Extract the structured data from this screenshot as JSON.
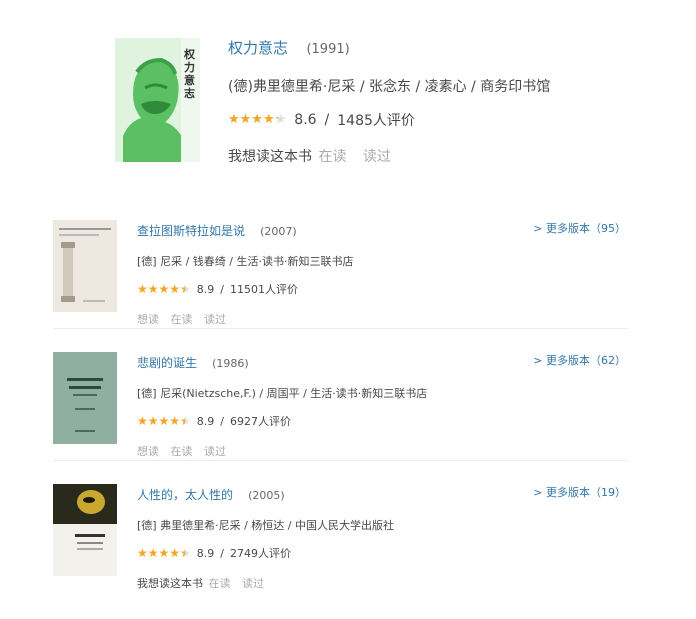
{
  "featured": {
    "title": "权力意志",
    "year": "(1991)",
    "meta": "(德)弗里德里希·尼采 / 张念东 / 凌素心 / 商务印书馆",
    "rating": "8.6",
    "rating_fraction": 0.86,
    "sep": "/",
    "ratings_count": "1485人评价",
    "action_want": "我想读这本书",
    "action_reading": "在读",
    "action_read": "读过",
    "cover_text": "权力意志"
  },
  "items": [
    {
      "title": "查拉图斯特拉如是说",
      "year": "(2007)",
      "more": "> 更多版本（95）",
      "meta": "[德] 尼采 / 钱春绮 / 生活·读书·新知三联书店",
      "rating": "8.9",
      "rating_fraction": 0.89,
      "sep": "/",
      "ratings_count": "11501人评价",
      "actions": [
        "想读",
        "在读",
        "读过"
      ],
      "cover_color": "#ede9e1"
    },
    {
      "title": "悲剧的诞生",
      "year": "(1986)",
      "more": "> 更多版本（62）",
      "meta": "[德] 尼采(Nietzsche,F.) / 周国平 / 生活·读书·新知三联书店",
      "rating": "8.9",
      "rating_fraction": 0.89,
      "sep": "/",
      "ratings_count": "6927人评价",
      "actions": [
        "想读",
        "在读",
        "读过"
      ],
      "cover_color": "#8fb0a0"
    },
    {
      "title": "人性的，太人性的",
      "year": "(2005)",
      "more": "> 更多版本（19）",
      "meta": "[德] 弗里德里希·尼采 / 杨恒达 / 中国人民大学出版社",
      "rating": "8.9",
      "rating_fraction": 0.89,
      "sep": "/",
      "ratings_count": "2749人评价",
      "actions": [
        "我想读这本书",
        "在读",
        "读过"
      ],
      "cover_color": "#f3f1ec"
    }
  ]
}
